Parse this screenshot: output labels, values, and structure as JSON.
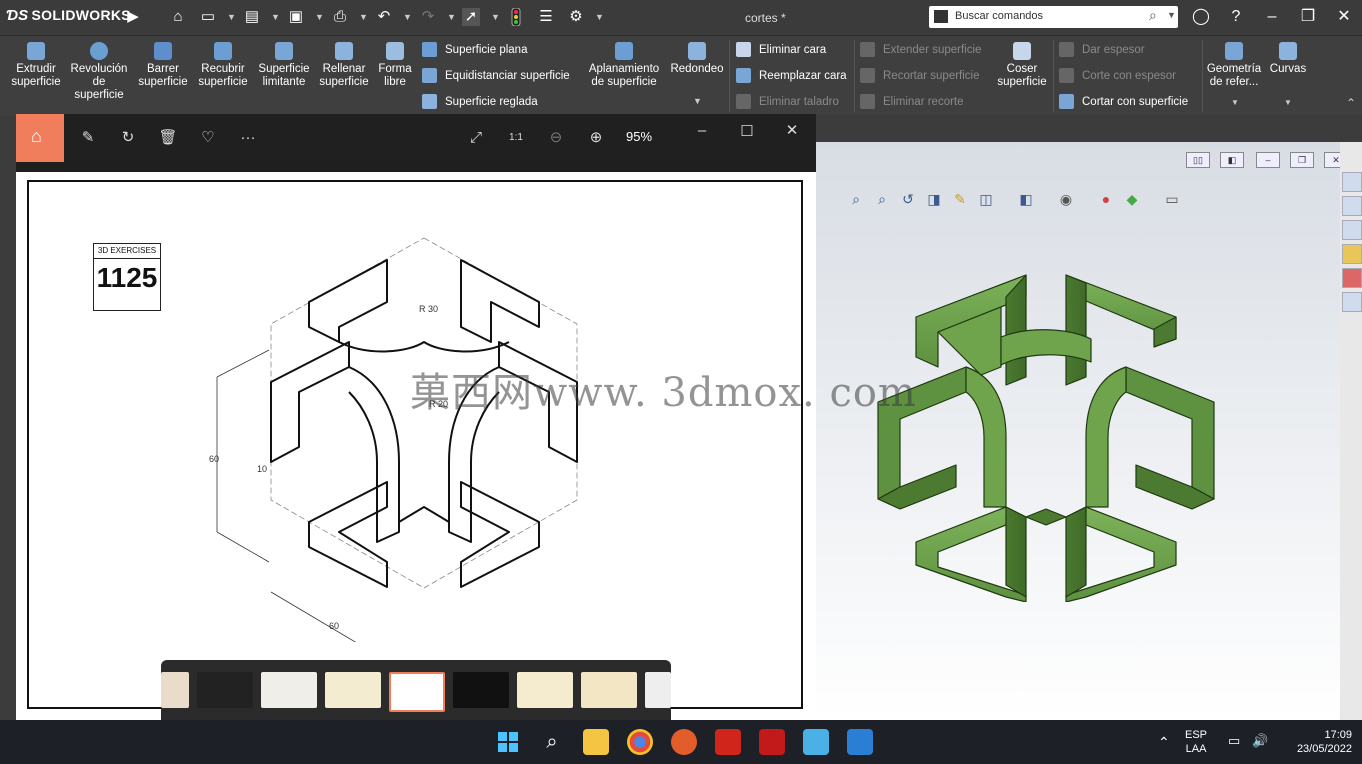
{
  "app": {
    "name": "SOLIDWORKS",
    "document_title": "cortes *",
    "search_placeholder": "Buscar comandos"
  },
  "ribbon": {
    "big_buttons": [
      {
        "label": "Extrudir superficie"
      },
      {
        "label": "Revolución de superficie"
      },
      {
        "label": "Barrer superficie"
      },
      {
        "label": "Recubrir superficie"
      },
      {
        "label": "Superficie limitante"
      },
      {
        "label": "Rellenar superficie"
      },
      {
        "label": "Forma libre"
      }
    ],
    "group1": [
      "Superficie plana",
      "Equidistanciar superficie",
      "Superficie reglada"
    ],
    "aplanamiento": "Aplanamiento de superficie",
    "redondeo": "Redondeo",
    "group2": [
      "Eliminar cara",
      "Reemplazar cara",
      "Eliminar taladro"
    ],
    "group3": [
      "Extender superficie",
      "Recortar superficie",
      "Eliminar recorte"
    ],
    "coser": "Coser superficie",
    "group4": [
      "Dar espesor",
      "Corte con espesor",
      "Cortar con superficie"
    ],
    "geometria": "Geometría de refer...",
    "curvas": "Curvas"
  },
  "viewer": {
    "zoom": "95%",
    "drawing": {
      "badge_title": "3D EXERCISES",
      "badge_number": "1125",
      "dims": [
        "R 30",
        "R 20",
        "10",
        "60",
        "60"
      ]
    },
    "watermark": "菓西网www. 3dmox. com"
  },
  "taskbar": {
    "lang": "ESP",
    "lang2": "LAA",
    "time": "17:09",
    "date": "23/05/2022"
  },
  "colors": {
    "viewer_accent": "#f07e5c",
    "model_green": "#5a8a3c"
  }
}
